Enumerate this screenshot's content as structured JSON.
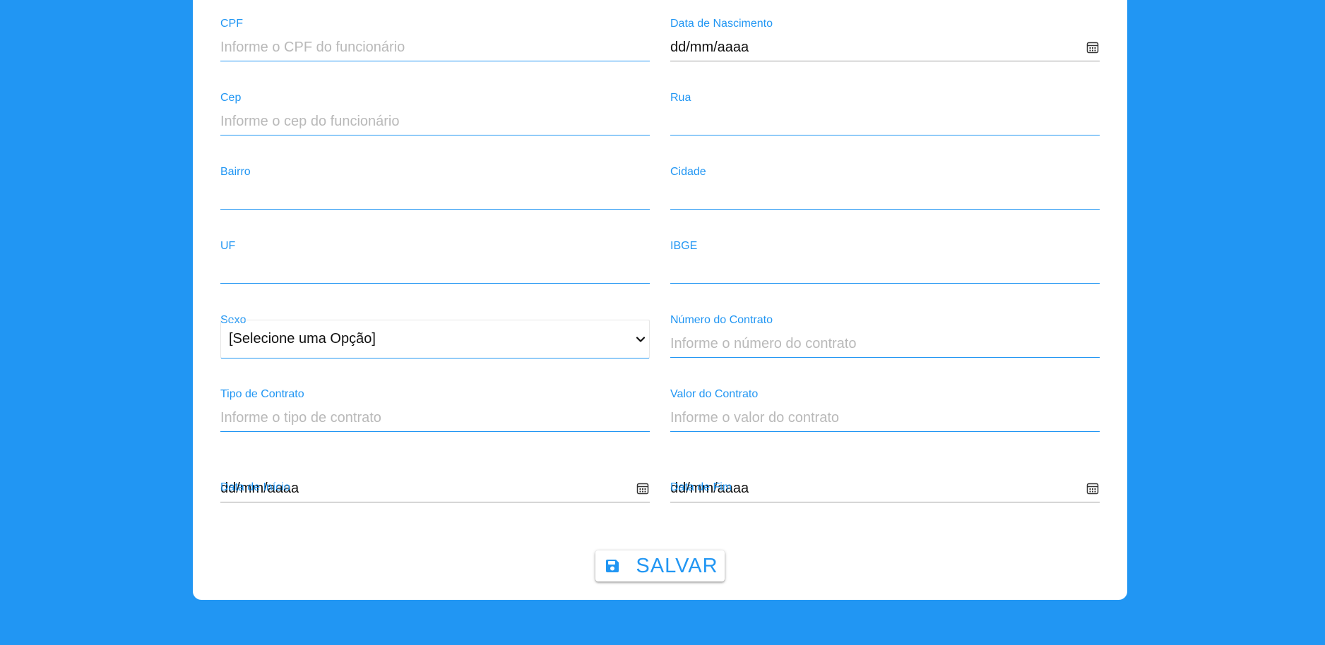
{
  "form": {
    "cpf": {
      "label": "CPF",
      "placeholder": "Informe o CPF do funcionário"
    },
    "data_nascimento": {
      "label": "Data de Nascimento",
      "value": "dd/mm/aaaa"
    },
    "cep": {
      "label": "Cep",
      "placeholder": "Informe o cep do funcionário"
    },
    "rua": {
      "label": "Rua",
      "value": ""
    },
    "bairro": {
      "label": "Bairro",
      "value": ""
    },
    "cidade": {
      "label": "Cidade",
      "value": ""
    },
    "uf": {
      "label": "UF",
      "value": ""
    },
    "ibge": {
      "label": "IBGE",
      "value": ""
    },
    "sexo": {
      "label": "Sexo",
      "selected": "[Selecione uma Opção]"
    },
    "numero_contrato": {
      "label": "Número do Contrato",
      "placeholder": "Informe o número do contrato"
    },
    "tipo_contrato": {
      "label": "Tipo de Contrato",
      "placeholder": "Informe o tipo de contrato"
    },
    "valor_contrato": {
      "label": "Valor do Contrato",
      "placeholder": "Informe o valor do contrato"
    },
    "data_inicio": {
      "label": "Data de Início",
      "value": "dd/mm/aaaa"
    },
    "data_fim": {
      "label": "Data de Fim",
      "value": "dd/mm/aaaa"
    }
  },
  "actions": {
    "save_label": "SALVAR",
    "save_icon": "floppy-disk-icon"
  },
  "colors": {
    "background": "#2196f3",
    "accent": "#2196f3",
    "card": "#ffffff",
    "placeholder": "#b9b9b9"
  }
}
